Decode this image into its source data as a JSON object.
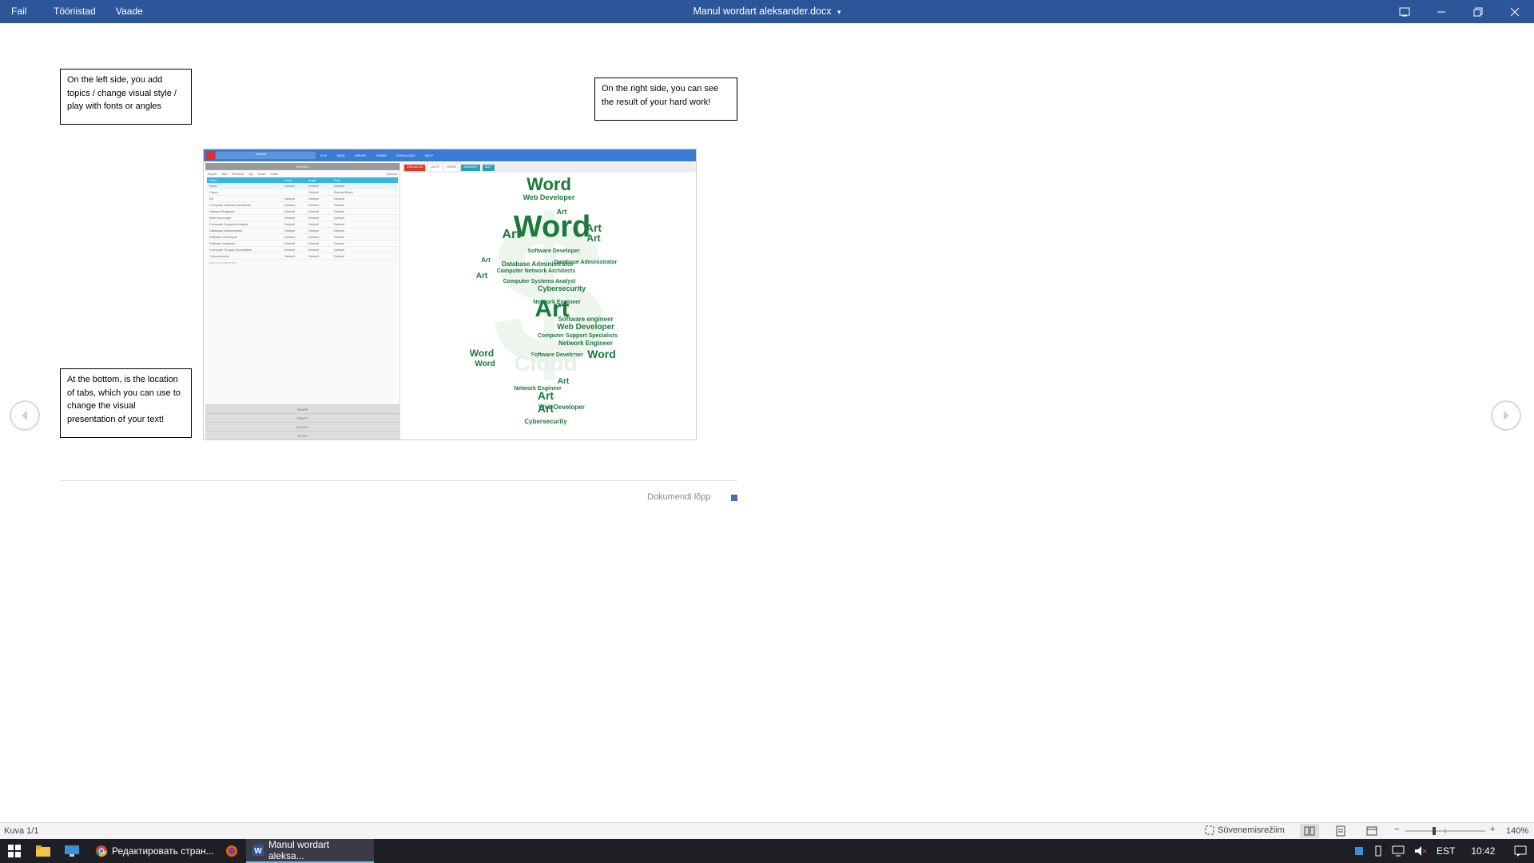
{
  "titlebar": {
    "menus": [
      "Fail",
      "Tööriistad",
      "Vaade"
    ],
    "title": "Manul wordart aleksander.docx",
    "title_dropdown": "▾",
    "bg_color": "#2b579a"
  },
  "document": {
    "callouts": {
      "left": "On the left side, you add topics / change visual style / play with fonts or angles",
      "right": "On the right side, you can see the result of your hard work!",
      "bottom": "At the bottom, is the location of tabs, which you can use to change the visual presentation of your text!"
    },
    "doc_end": "Dokumendi lõpp",
    "embedded": {
      "search": "wordart",
      "menu": [
        "FILE",
        "SAVE",
        "ORDER",
        "SHARE",
        "DOWNLOAD",
        "HELP"
      ],
      "words_header": "WORDS",
      "word_buttons": [
        "Import",
        "Add",
        "Remove",
        "Up",
        "Down",
        "Clear",
        "Options"
      ],
      "columns": [
        "Word",
        "Color",
        "Angle",
        "Font"
      ],
      "rows": [
        [
          "Word",
          "Default",
          "Default",
          "Default"
        ],
        [
          "Cloud",
          "",
          "Default",
          "Roboto Black"
        ],
        [
          "Art",
          "Default",
          "Default",
          "Default"
        ],
        [
          "Computer Network Architects",
          "Default",
          "Default",
          "Default"
        ],
        [
          "Network Engineer",
          "Default",
          "Default",
          "Default"
        ],
        [
          "Web Developer",
          "Default",
          "Default",
          "Default"
        ],
        [
          "Computer Systems Analyst",
          "Default",
          "Default",
          "Default"
        ],
        [
          "Database Administrator",
          "Default",
          "Default",
          "Default"
        ],
        [
          "Software Developer",
          "Default",
          "Default",
          "Default"
        ],
        [
          "Software engineer",
          "Default",
          "Default",
          "Default"
        ],
        [
          "Computer Support Specialists",
          "Default",
          "Default",
          "Default"
        ],
        [
          "Cybersecurity",
          "Default",
          "Default",
          "Default"
        ]
      ],
      "add_placeholder": "type in a new word",
      "tabs": [
        "SHAPE",
        "FONTS",
        "LAYOUT",
        "STYLE"
      ],
      "right_buttons": [
        "VISUALIZE",
        "LIGHT",
        "MORE",
        "ANIMATE",
        "EDIT"
      ],
      "cloud_color": "#1b7a3a",
      "cloud_words": [
        "Word",
        "Art",
        "Web Developer",
        "Database Administrator",
        "Software Developer",
        "Computer Systems Analyst",
        "Computer Network Architects",
        "Cybersecurity",
        "Network Engineer",
        "Software engineer",
        "Computer Support Specialists",
        "Cloud"
      ]
    }
  },
  "statusbar": {
    "page": "Kuva 1/1",
    "focus": "Süvenemisrežiim",
    "zoom": "140%",
    "zoom_minus": "−",
    "zoom_plus": "+",
    "zoom_fraction": 0.35
  },
  "taskbar": {
    "apps": [
      {
        "label": "Редактировать стран..."
      },
      {
        "label": "Manul wordart aleksa..."
      }
    ],
    "tray": {
      "lang": "EST",
      "time": "10:42"
    }
  }
}
